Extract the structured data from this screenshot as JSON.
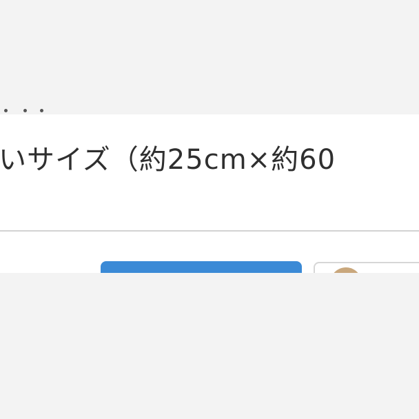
{
  "listing": {
    "description_line": "いサイズ（約25cm×約60"
  },
  "actions": {
    "primary_label": "",
    "secondary_label": ""
  },
  "colors": {
    "primary_button": "#3b8ad6",
    "text": "#2f2f2f",
    "divider": "#d2d2d2",
    "background": "#f3f3f3"
  },
  "icons": {
    "avatar": "user-avatar-icon"
  }
}
